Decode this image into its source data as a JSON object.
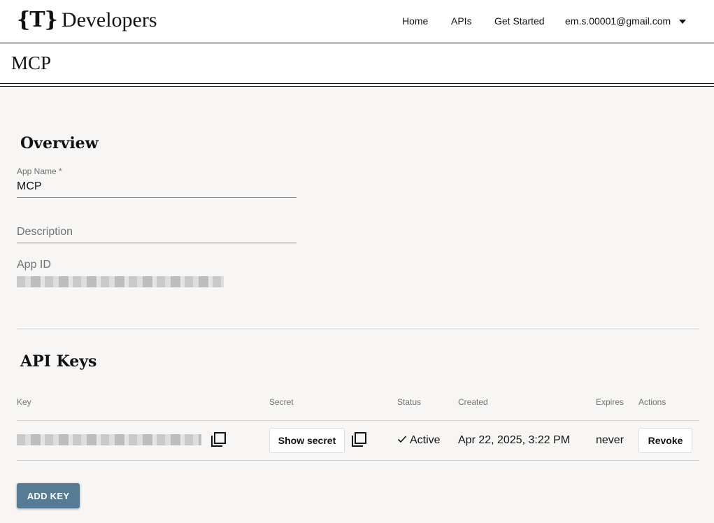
{
  "header": {
    "logo_mark": "{T}",
    "logo_text": "Developers",
    "nav": {
      "home": "Home",
      "apis": "APIs",
      "get_started": "Get Started"
    },
    "user_email": "em.s.00001@gmail.com"
  },
  "page": {
    "title": "MCP"
  },
  "overview": {
    "heading": "Overview",
    "app_name_label": "App Name *",
    "app_name_value": "MCP",
    "description_placeholder": "Description",
    "app_id_label": "App ID"
  },
  "api_keys": {
    "heading": "API Keys",
    "columns": {
      "key": "Key",
      "secret": "Secret",
      "status": "Status",
      "created": "Created",
      "expires": "Expires",
      "actions": "Actions"
    },
    "rows": [
      {
        "show_secret_label": "Show secret",
        "status": "Active",
        "created": "Apr 22, 2025, 3:22 PM",
        "expires": "never",
        "revoke_label": "Revoke"
      }
    ],
    "add_key_label": "ADD KEY"
  },
  "colors": {
    "accent_button": "#567b95",
    "background": "#f7f6f4"
  }
}
